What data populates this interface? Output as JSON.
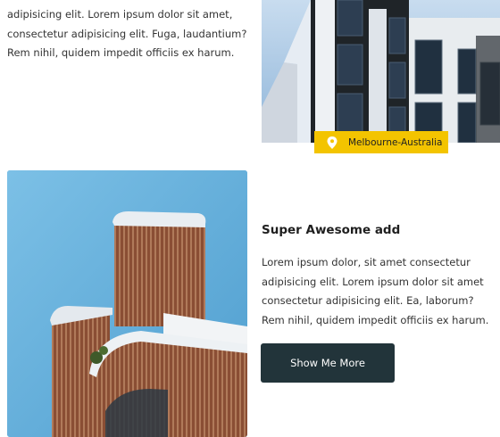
{
  "top_listing": {
    "description": "adipisicing elit. Lorem ipsum dolor sit amet, consectetur adipisicing elit. Fuga, laudantium? Rem nihil, quidem impedit officiis ex harum.",
    "location": "Melbourne-Australia",
    "location_icon": "map-pin-icon"
  },
  "feature_card": {
    "title": "Super Awesome add",
    "description": "Lorem ipsum dolor, sit amet consectetur adipisicing elit. Lorem ipsum dolor sit amet consectetur adipisicing elit. Ea, laborum? Rem nihil, quidem impedit officiis ex harum.",
    "button_label": "Show Me More"
  },
  "colors": {
    "badge_yellow": "#f3c400",
    "button_dark": "#22343a",
    "sky_blue": "#6fb6de",
    "wood": "#8a4e34"
  }
}
